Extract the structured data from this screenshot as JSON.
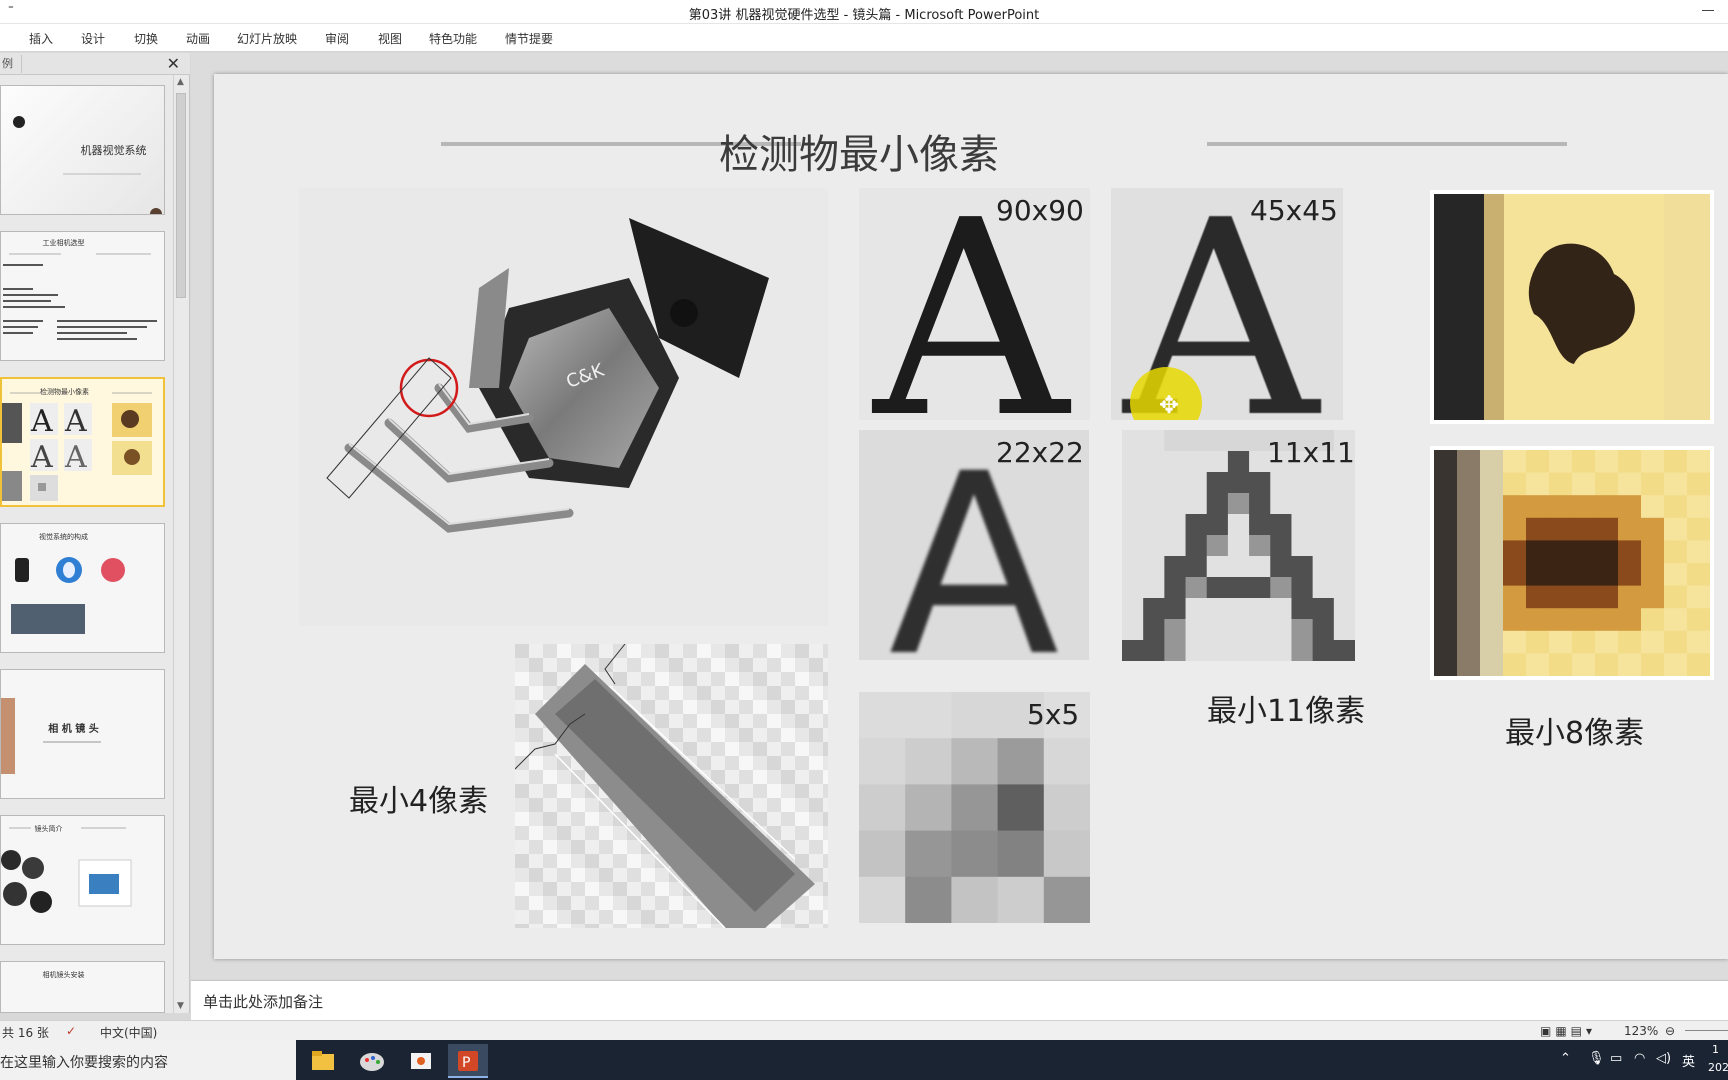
{
  "window": {
    "title": "第03讲 机器视觉硬件选型 - 镜头篇 - Microsoft PowerPoint",
    "quick_access": "⁼"
  },
  "ribbon": {
    "tabs": [
      "插入",
      "设计",
      "切换",
      "动画",
      "幻灯片放映",
      "审阅",
      "视图",
      "特色功能",
      "情节提要"
    ]
  },
  "pane": {
    "tab_fragment": "例",
    "close": "✕",
    "thumbs": [
      {
        "title": "机器视觉系统"
      },
      {
        "title": "工业相机选型"
      },
      {
        "title": "检测物最小像素"
      },
      {
        "title": "视觉系统的构成"
      },
      {
        "title": "相 机 镜 头"
      },
      {
        "title": "镜头简介"
      },
      {
        "title": "相机镜头安装"
      }
    ]
  },
  "slide": {
    "title": "检测物最小像素",
    "labels": {
      "a90": "90x90",
      "a45": "45x45",
      "a22": "22x22",
      "a11": "11x11",
      "a5": "5x5"
    },
    "captions": {
      "min4": "最小4像素",
      "min11": "最小11像素",
      "min8": "最小8像素"
    },
    "switch_marking": "C&K"
  },
  "notes": {
    "placeholder": "单击此处添加备注"
  },
  "status": {
    "slide_count": "共 16 张",
    "language": "中文(中国)",
    "zoom": "123%"
  },
  "taskbar": {
    "search_placeholder": "在这里输入你要搜索的内容",
    "tray_lang": "英",
    "tray_time_frag": "1",
    "tray_date_frag": "202"
  },
  "colors": {
    "accent": "#f0c23a",
    "highlight_circle": "#e8d400",
    "taskbar": "#1a2433"
  }
}
